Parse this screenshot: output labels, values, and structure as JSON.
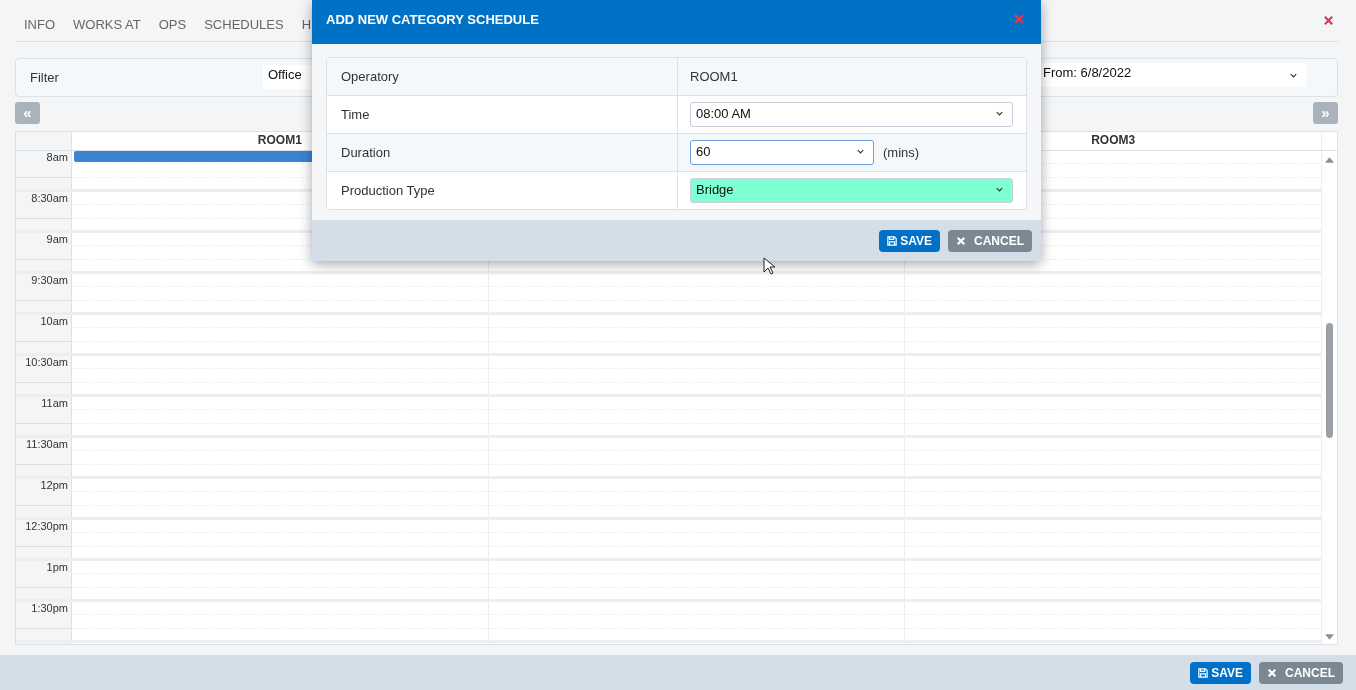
{
  "tabs": [
    {
      "label": "INFO"
    },
    {
      "label": "WORKS AT"
    },
    {
      "label": "OPS"
    },
    {
      "label": "SCHEDULES"
    },
    {
      "label": "H"
    }
  ],
  "filter": {
    "label": "Filter",
    "office": "Office",
    "date_range": "From: 6/8/2022"
  },
  "nav": {
    "prev": "«",
    "next": "»"
  },
  "calendar": {
    "columns": [
      {
        "label": "ROOM1",
        "booked": true
      },
      {
        "label": "ROOM3",
        "booked": false
      }
    ],
    "times": [
      "8am",
      "8:30am",
      "9am",
      "9:30am",
      "10am",
      "10:30am",
      "11am",
      "11:30am",
      "12pm",
      "12:30pm",
      "1pm",
      "1:30pm"
    ]
  },
  "dialog": {
    "title": "ADD NEW CATEGORY SCHEDULE",
    "rows": [
      {
        "label": "Operatory",
        "kind": "text",
        "value": "ROOM1"
      },
      {
        "label": "Time",
        "kind": "select",
        "value": "08:00 AM",
        "focused": false
      },
      {
        "label": "Duration",
        "kind": "select",
        "value": "60",
        "unit": "(mins)",
        "focused": true
      },
      {
        "label": "Production Type",
        "kind": "select",
        "value": "Bridge",
        "focused": false,
        "color": "#7fffd4"
      }
    ],
    "buttons": [
      {
        "kind": "save",
        "label": "SAVE"
      },
      {
        "kind": "cancel",
        "label": "CANCEL"
      }
    ]
  },
  "footer": {
    "buttons": [
      {
        "kind": "save",
        "label": "SAVE"
      },
      {
        "kind": "cancel",
        "label": "CANCEL"
      }
    ]
  }
}
